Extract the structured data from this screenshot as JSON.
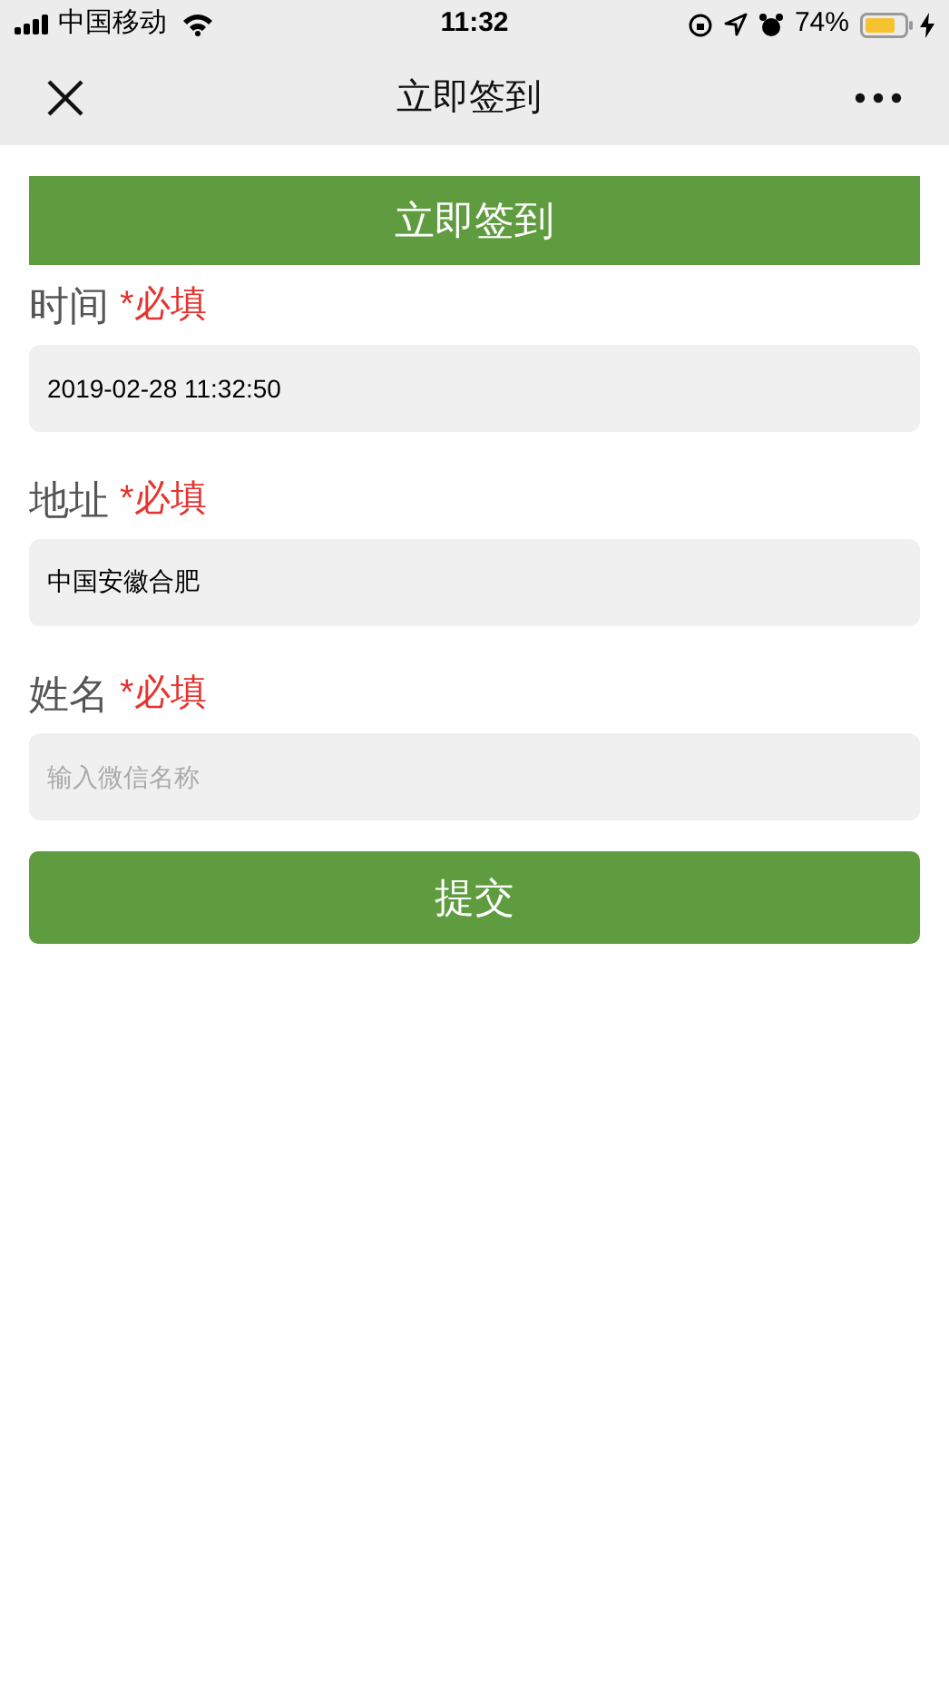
{
  "status_bar": {
    "carrier": "中国移动",
    "time": "11:32",
    "battery": "74%"
  },
  "nav_bar": {
    "title": "立即签到"
  },
  "banner": {
    "title": "立即签到"
  },
  "fields": [
    {
      "label": "时间",
      "required_mark": "*必填",
      "value": "2019-02-28 11:32:50"
    },
    {
      "label": "地址",
      "required_mark": "*必填",
      "value": "中国安徽合肥"
    },
    {
      "label": "姓名",
      "required_mark": "*必填",
      "placeholder": "输入微信名称"
    }
  ],
  "submit_button": "提交"
}
